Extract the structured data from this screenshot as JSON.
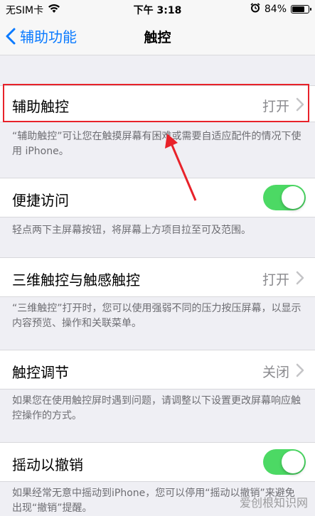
{
  "status_bar": {
    "carrier": "无SIM卡",
    "time": "下午 3:18",
    "battery": "84%",
    "battery_level": 0.84
  },
  "nav": {
    "back_label": "辅助功能",
    "title": "触控"
  },
  "sections": [
    {
      "label": "辅助触控",
      "value": "打开",
      "footer": "“辅助触控”可让您在触摸屏幕有困难或需要自适应配件的情况下使用 iPhone。"
    },
    {
      "label": "便捷访问",
      "toggle_on": true,
      "footer": "轻点两下主屏幕按钮，将屏幕上方项目拉至可及范围。"
    },
    {
      "label": "三维触控与触感触控",
      "value": "打开",
      "footer": "“三维触控”打开时，您可以使用强弱不同的压力按压屏幕，以显示内容预览、操作和关联菜单。"
    },
    {
      "label": "触控调节",
      "value": "关闭",
      "footer": "如果您在使用触控屏时遇到问题，请调整以下设置更改屏幕响应触控操作的方式。"
    },
    {
      "label": "摇动以撤销",
      "toggle_on": true,
      "footer": "如果经常无意中摇动到iPhone，您可以停用“摇动以撤销”来避免出现“撤销”提醒。"
    }
  ],
  "watermark": "爱创根知识网",
  "colors": {
    "accent": "#0a7aff",
    "toggle_on": "#4cd964",
    "annotation": "#e8222a"
  }
}
